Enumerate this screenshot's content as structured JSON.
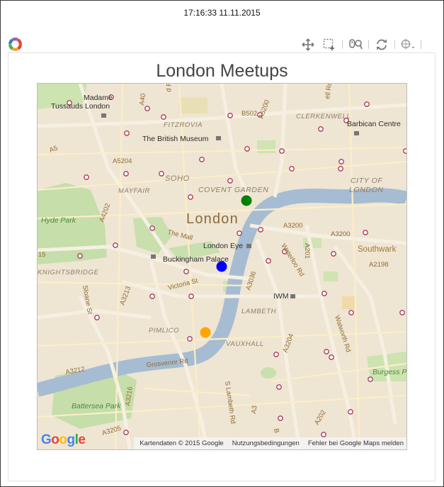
{
  "timestamp": "17:16:33 11.11.2015",
  "toolbar": {
    "tools": [
      "pan-icon",
      "box-zoom-icon",
      "wheel-zoom-icon",
      "reset-icon",
      "hover-icon"
    ],
    "active_color": "#26aae1"
  },
  "plot": {
    "title": "London Meetups"
  },
  "map": {
    "center_label": "London",
    "district_labels": [
      {
        "key": "fitzrovia",
        "text": "FITZROVIA"
      },
      {
        "key": "clerkenwell",
        "text": "CLERKENWELL"
      },
      {
        "key": "soho",
        "text": "SOHO"
      },
      {
        "key": "mayfair",
        "text": "MAYFAIR"
      },
      {
        "key": "covent_garden",
        "text": "COVENT GARDEN"
      },
      {
        "key": "city1",
        "text": "CITY OF"
      },
      {
        "key": "city2",
        "text": "LONDON"
      },
      {
        "key": "southwark",
        "text": "Southwark"
      },
      {
        "key": "knightsbridge",
        "text": "KNIGHTSBRIDGE"
      },
      {
        "key": "lambeth",
        "text": "LAMBETH"
      },
      {
        "key": "pimlico",
        "text": "PIMLICO"
      },
      {
        "key": "vauxhall",
        "text": "VAUXHALL"
      }
    ],
    "place_labels": [
      {
        "key": "tussauds1",
        "text": "Madame"
      },
      {
        "key": "tussauds2",
        "text": "Tussauds London"
      },
      {
        "key": "barbican",
        "text": "Barbican Centre"
      },
      {
        "key": "museum",
        "text": "The British Museum"
      },
      {
        "key": "eye",
        "text": "London Eye"
      },
      {
        "key": "palace",
        "text": "Buckingham Palace"
      },
      {
        "key": "iwm",
        "text": "IWM"
      },
      {
        "key": "hyde",
        "text": "Hyde Park"
      },
      {
        "key": "battersea",
        "text": "Battersea Park"
      },
      {
        "key": "burgess",
        "text": "Burgess Pa"
      }
    ],
    "road_labels": [
      {
        "key": "a5",
        "text": "A5"
      },
      {
        "key": "a5204",
        "text": "A5204"
      },
      {
        "key": "b502",
        "text": "B502"
      },
      {
        "key": "a5200",
        "text": "A5200"
      },
      {
        "key": "a4202",
        "text": "A4202"
      },
      {
        "key": "the_mall",
        "text": "The Mall"
      },
      {
        "key": "a3200a",
        "text": "A3200"
      },
      {
        "key": "a3200b",
        "text": "A3200"
      },
      {
        "key": "waterloo",
        "text": "Waterloo Rd"
      },
      {
        "key": "a201",
        "text": "A201"
      },
      {
        "key": "a2198",
        "text": "A2198"
      },
      {
        "key": "victoria",
        "text": "Victoria St"
      },
      {
        "key": "a3036",
        "text": "A3036"
      },
      {
        "key": "sloane",
        "text": "Sloane St"
      },
      {
        "key": "a3213",
        "text": "A3213"
      },
      {
        "key": "a3204",
        "text": "A3204"
      },
      {
        "key": "walworth",
        "text": "Walworth Rd"
      },
      {
        "key": "grosvenor",
        "text": "Grosvenor Rd"
      },
      {
        "key": "a3212",
        "text": "A3212"
      },
      {
        "key": "a3216",
        "text": "A3216"
      },
      {
        "key": "a3205",
        "text": "A3205"
      },
      {
        "key": "slambeth",
        "text": "S Lambeth Rd"
      },
      {
        "key": "a3",
        "text": "A3"
      },
      {
        "key": "a202",
        "text": "A202"
      },
      {
        "key": "b_edge",
        "text": "B"
      },
      {
        "key": "fifteen",
        "text": "15"
      },
      {
        "key": "a40",
        "text": "A40"
      },
      {
        "key": "d_rd",
        "text": "d Rd"
      },
      {
        "key": "ell_rd",
        "text": "ell Rd"
      }
    ],
    "attribution": {
      "map_data": "Kartendaten © 2015 Google",
      "terms": "Nutzungsbedingungen",
      "report": "Fehler bei Google Maps melden"
    },
    "google_logo": [
      "G",
      "o",
      "o",
      "g",
      "l",
      "e"
    ],
    "google_colors": [
      "#4285f4",
      "#ea4335",
      "#fbbc05",
      "#4285f4",
      "#34a853",
      "#ea4335"
    ]
  },
  "meetups": [
    {
      "color": "#008000"
    },
    {
      "color": "#0000ff"
    },
    {
      "color": "#ffa500"
    }
  ]
}
